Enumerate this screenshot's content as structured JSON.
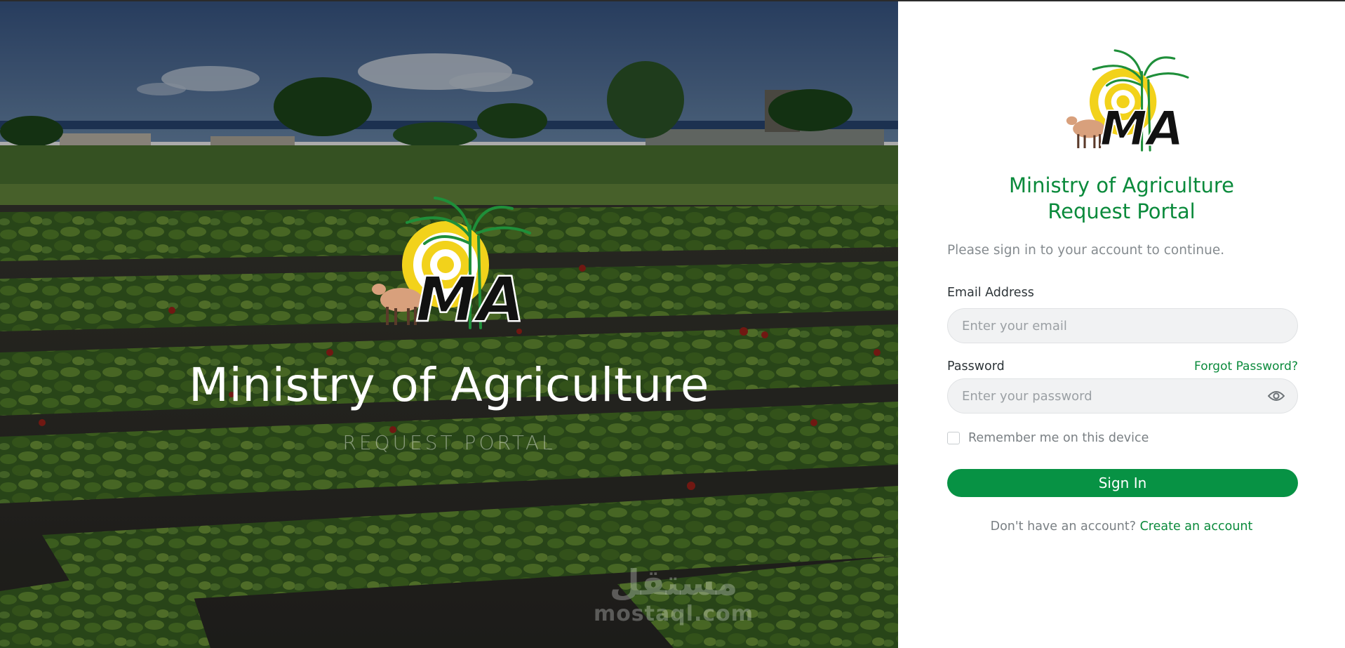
{
  "hero": {
    "title": "Ministry of Agriculture",
    "subtitle": "REQUEST PORTAL",
    "logo_text": "MA",
    "watermark_arabic": "مستقل",
    "watermark_latin": "mostaql.com"
  },
  "panel": {
    "logo_text": "MA",
    "title_line1": "Ministry of Agriculture",
    "title_line2": "Request Portal",
    "subtitle": "Please sign in to your account to continue.",
    "email": {
      "label": "Email Address",
      "placeholder": "Enter your email",
      "value": ""
    },
    "password": {
      "label": "Password",
      "placeholder": "Enter your password",
      "value": "",
      "toggle_icon": "eye-icon"
    },
    "forgot_password": "Forgot Password?",
    "remember_me": {
      "label": "Remember me on this device",
      "checked": false
    },
    "sign_in_label": "Sign In",
    "footer_text": "Don't have an account?",
    "footer_link": "Create an account"
  },
  "colors": {
    "brand_green": "#0a8a3b",
    "button_green": "#079244",
    "logo_yellow": "#f2d21b"
  }
}
